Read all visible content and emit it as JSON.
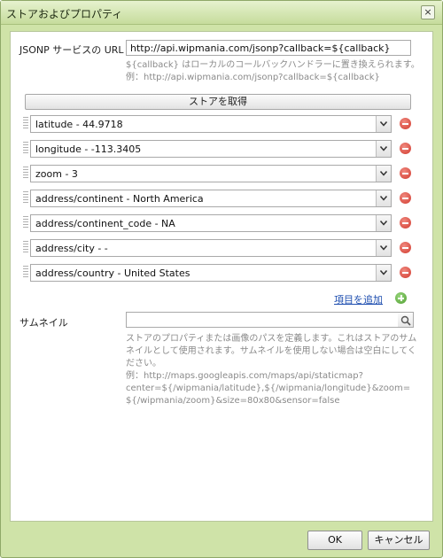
{
  "window": {
    "title": "ストアおよびプロパティ",
    "close_label": "×"
  },
  "jsonp": {
    "label": "JSONP サービスの URL",
    "value": "http://api.wipmania.com/jsonp?callback=${callback}",
    "hint_line1": "${callback} はローカルのコールバックハンドラーに置き換えられます。",
    "hint_line2": "例：http://api.wipmania.com/jsonp?callback=${callback}"
  },
  "fetch_button_label": "ストアを取得",
  "properties": [
    {
      "value": "latitude - 44.9718"
    },
    {
      "value": "longitude - -113.3405"
    },
    {
      "value": "zoom - 3"
    },
    {
      "value": "address/continent - North America"
    },
    {
      "value": "address/continent_code - NA"
    },
    {
      "value": "address/city - -"
    },
    {
      "value": "address/country - United States"
    }
  ],
  "add_item_label": "項目を追加",
  "thumbnail": {
    "label": "サムネイル",
    "value": "",
    "hint_lines": [
      "ストアのプロパティまたは画像のパスを定義します。これはストアのサム",
      "ネイルとして使用されます。サムネイルを使用しない場合は空白にしてく",
      "ださい。",
      "例：http://maps.googleapis.com/maps/api/staticmap?",
      "center=${/wipmania/latitude},${/wipmania/longitude}&zoom=",
      "${/wipmania/zoom}&size=80x80&sensor=false"
    ]
  },
  "footer": {
    "ok_label": "OK",
    "cancel_label": "キャンセル"
  },
  "colors": {
    "frame": "#cfe3a8",
    "remove": "#d23a2e",
    "add": "#4f9e2f",
    "link": "#1f4fb0"
  }
}
